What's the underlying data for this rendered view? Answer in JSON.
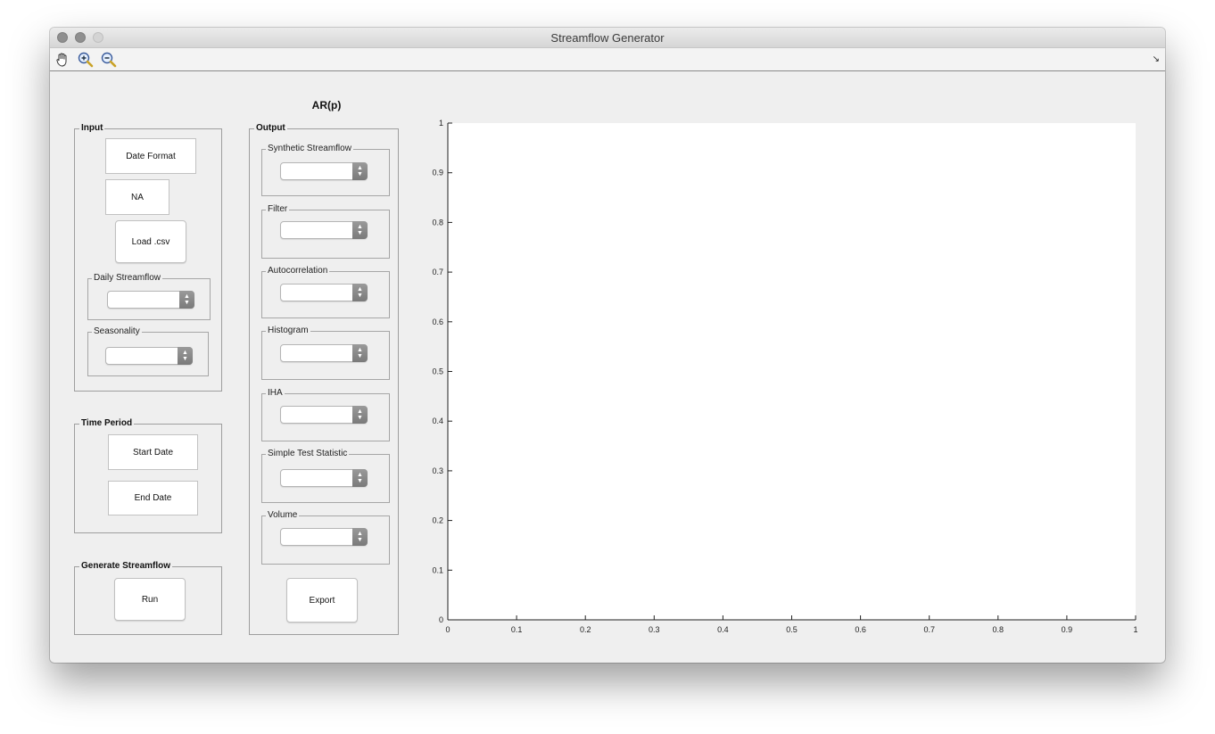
{
  "window": {
    "title": "Streamflow Generator"
  },
  "toolbar": {
    "icons": [
      "pan-hand-icon",
      "zoom-in-icon",
      "zoom-out-icon"
    ]
  },
  "input": {
    "label": "Input",
    "date_format": "Date Format",
    "na": "NA",
    "load_button": "Load .csv",
    "daily_streamflow_label": "Daily Streamflow",
    "daily_streamflow_value": "",
    "seasonality_label": "Seasonality",
    "seasonality_value": ""
  },
  "time_period": {
    "label": "Time Period",
    "start_date": "Start Date",
    "end_date": "End Date"
  },
  "generate": {
    "label": "Generate Streamflow",
    "run_button": "Run"
  },
  "model_title": "AR(p)",
  "output": {
    "label": "Output",
    "groups": [
      {
        "label": "Synthetic Streamflow",
        "value": ""
      },
      {
        "label": "Filter",
        "value": ""
      },
      {
        "label": "Autocorrelation",
        "value": ""
      },
      {
        "label": "Histogram",
        "value": ""
      },
      {
        "label": "IHA",
        "value": ""
      },
      {
        "label": "Simple Test Statistic",
        "value": ""
      },
      {
        "label": "Volume",
        "value": ""
      }
    ],
    "export_button": "Export"
  },
  "chart_data": {
    "type": "line",
    "series": [],
    "xlim": [
      0,
      1
    ],
    "ylim": [
      0,
      1
    ],
    "xticks": [
      "0",
      "0.1",
      "0.2",
      "0.3",
      "0.4",
      "0.5",
      "0.6",
      "0.7",
      "0.8",
      "0.9",
      "1"
    ],
    "yticks": [
      "0",
      "0.1",
      "0.2",
      "0.3",
      "0.4",
      "0.5",
      "0.6",
      "0.7",
      "0.8",
      "0.9",
      "1"
    ],
    "grid": false
  }
}
